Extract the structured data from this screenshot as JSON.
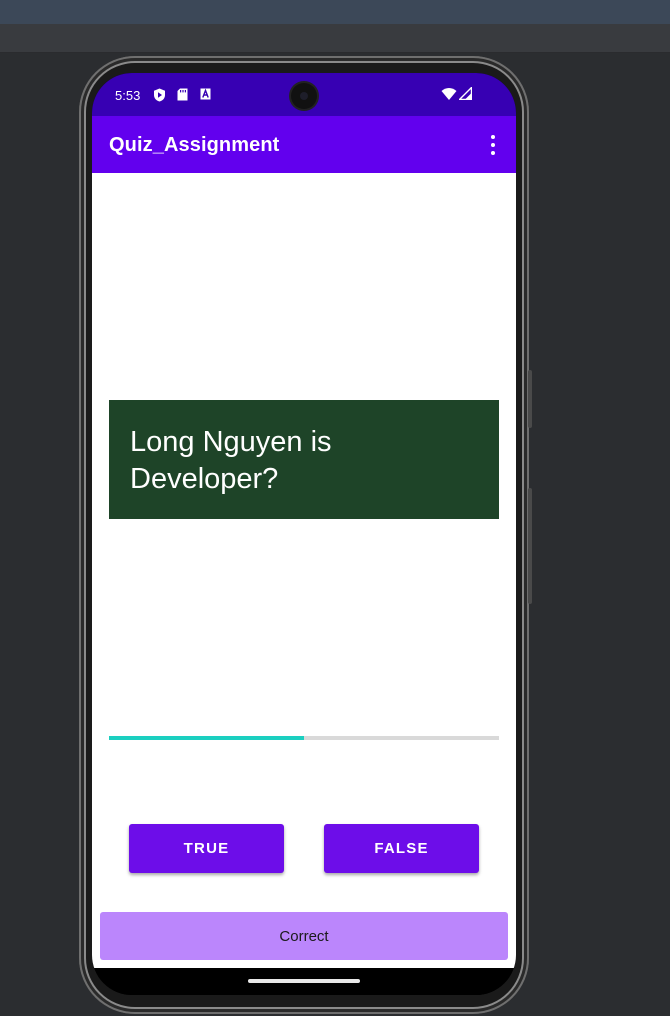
{
  "status_bar": {
    "time": "5:53",
    "icons": [
      "shield-play-icon",
      "sd-card-icon",
      "font-a-icon",
      "wifi-icon",
      "cell-signal-icon"
    ]
  },
  "app_bar": {
    "title": "Quiz_Assignment",
    "menu_icon": "more-vert-icon"
  },
  "question": {
    "text": "Long Nguyen is Developer?"
  },
  "progress": {
    "fraction": 0.5
  },
  "buttons": {
    "true_label": "TRUE",
    "false_label": "FALSE"
  },
  "result": {
    "text": "Correct"
  },
  "colors": {
    "status_bar": "#3700b3",
    "app_bar": "#6200ee",
    "question_bg": "#1e4428",
    "progress_fill": "#1bcfc0",
    "button": "#6d0de9",
    "result_bar": "#bb86fc"
  }
}
